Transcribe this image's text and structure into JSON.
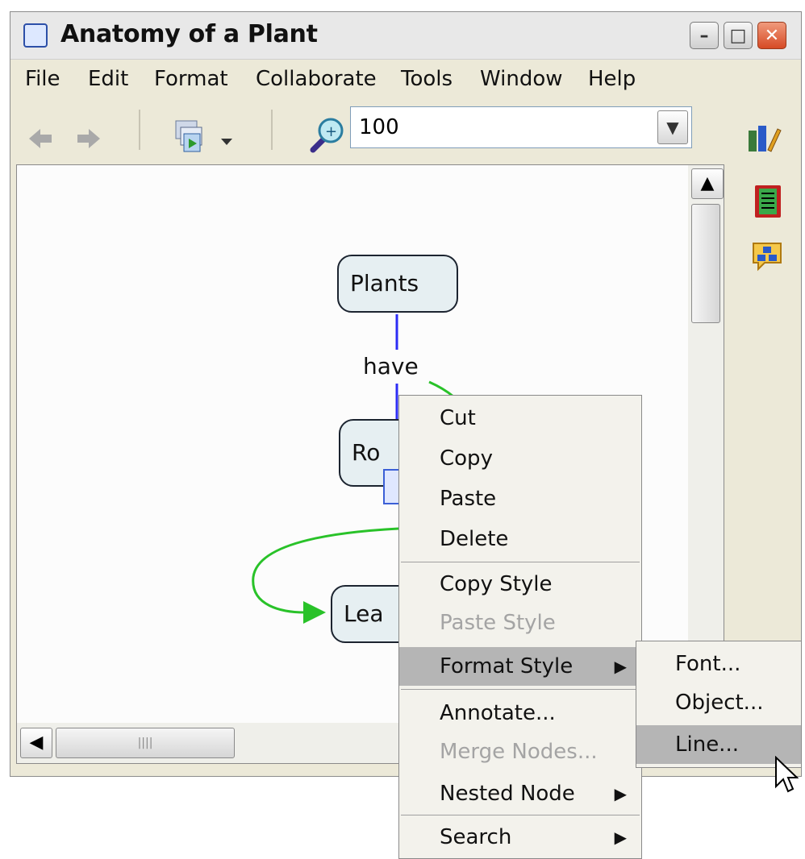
{
  "window": {
    "title": "Anatomy of a Plant"
  },
  "menubar": {
    "items": [
      "File",
      "Edit",
      "Format",
      "Collaborate",
      "Tools",
      "Window",
      "Help"
    ]
  },
  "toolbar": {
    "zoom_value": "100"
  },
  "map": {
    "concepts": [
      "Plants",
      "Ro",
      "Lea"
    ],
    "link_phrase": "have"
  },
  "context_menu": {
    "items": [
      "Cut",
      "Copy",
      "Paste",
      "Delete",
      "Copy Style",
      "Paste Style",
      "Format Style",
      "Annotate...",
      "Merge Nodes...",
      "Nested Node",
      "Search"
    ]
  },
  "submenu": {
    "items": [
      "Font...",
      "Object...",
      "Line..."
    ]
  },
  "icons": [
    "app-icon",
    "back-arrow-icon",
    "forward-arrow-icon",
    "view-icon",
    "zoom-icon",
    "style-icon",
    "notes-icon",
    "share-icon",
    "cursor-icon"
  ],
  "colors": {
    "node_fill": "#e6eff2",
    "link_line": "#2d2df5",
    "connector_green": "#29c229",
    "menu_highlight": "#b5b5b5"
  }
}
